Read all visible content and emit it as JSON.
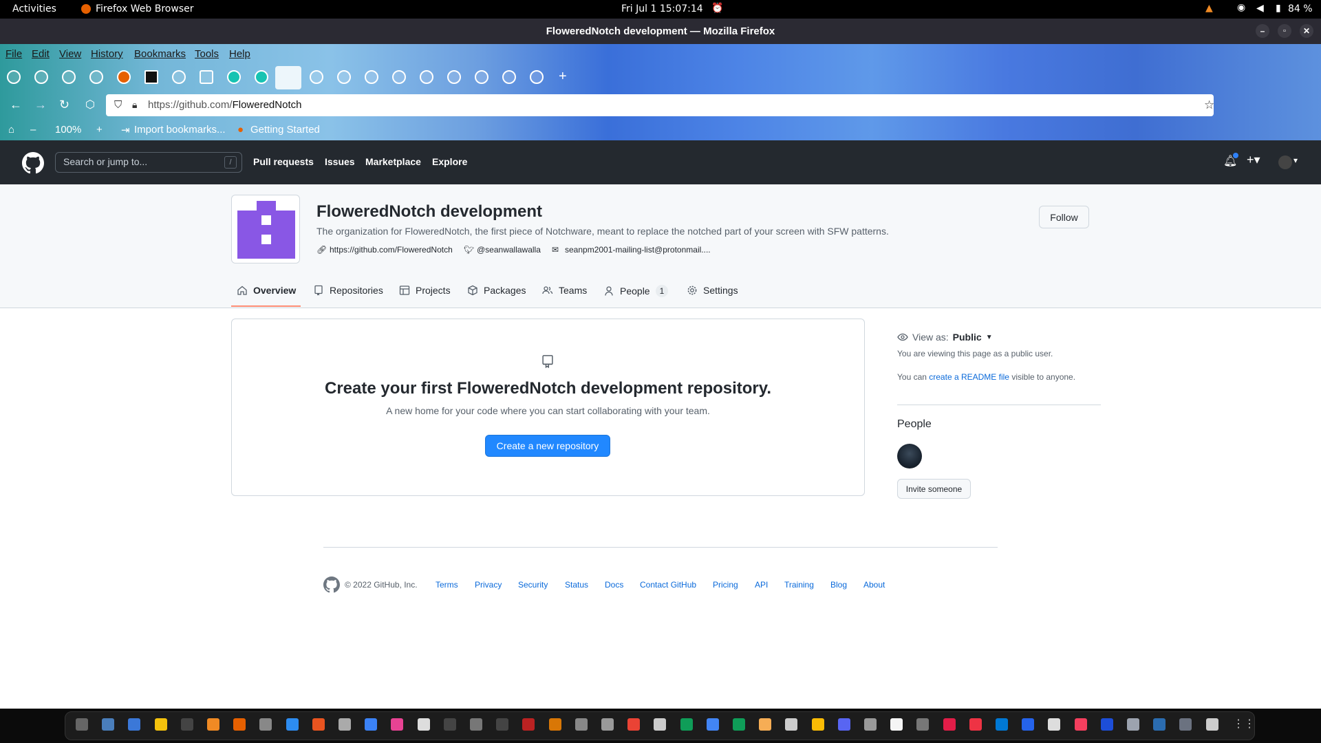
{
  "system": {
    "activities": "Activities",
    "app_name": "Firefox Web Browser",
    "clock": "Fri Jul 1  15:07:14",
    "battery": "84 %"
  },
  "browser": {
    "window_title": "FloweredNotch development — Mozilla Firefox",
    "menu": [
      "File",
      "Edit",
      "View",
      "History",
      "Bookmarks",
      "Tools",
      "Help"
    ],
    "url_host": "https://github.com/",
    "url_path": "FloweredNotch",
    "zoom": "100%",
    "bookmarks": [
      "Import bookmarks...",
      "Getting Started"
    ]
  },
  "gh": {
    "search_placeholder": "Search or jump to...",
    "search_key": "/",
    "nav": [
      "Pull requests",
      "Issues",
      "Marketplace",
      "Explore"
    ]
  },
  "org": {
    "name": "FloweredNotch development",
    "description": "The organization for FloweredNotch, the first piece of Notchware, meant to replace the notched part of your screen with SFW patterns.",
    "website": "https://github.com/FloweredNotch",
    "twitter": "@seanwallawalla",
    "email": "seanpm2001-mailing-list@protonmail....",
    "follow": "Follow",
    "accent": "#8957e5"
  },
  "tabs": {
    "overview": "Overview",
    "repositories": "Repositories",
    "projects": "Projects",
    "packages": "Packages",
    "teams": "Teams",
    "people": "People",
    "people_count": "1",
    "settings": "Settings"
  },
  "blank": {
    "heading": "Create your first FloweredNotch development repository.",
    "sub": "A new home for your code where you can start collaborating with your team.",
    "button": "Create a new repository"
  },
  "sidebar": {
    "view_as_label": "View as:",
    "view_as_value": "Public",
    "viewing_note": "You are viewing this page as a public user.",
    "readme_pre": "You can ",
    "readme_link": "create a README file",
    "readme_post": " visible to anyone.",
    "people_heading": "People",
    "invite": "Invite someone"
  },
  "footer": {
    "copyright": "© 2022 GitHub, Inc.",
    "links": [
      "Terms",
      "Privacy",
      "Security",
      "Status",
      "Docs",
      "Contact GitHub",
      "Pricing",
      "API",
      "Training",
      "Blog",
      "About"
    ]
  },
  "colors": {
    "gh_header": "#24292f",
    "link": "#0969da",
    "primary_button": "#2188ff",
    "tab_underline": "#fd8c73"
  }
}
